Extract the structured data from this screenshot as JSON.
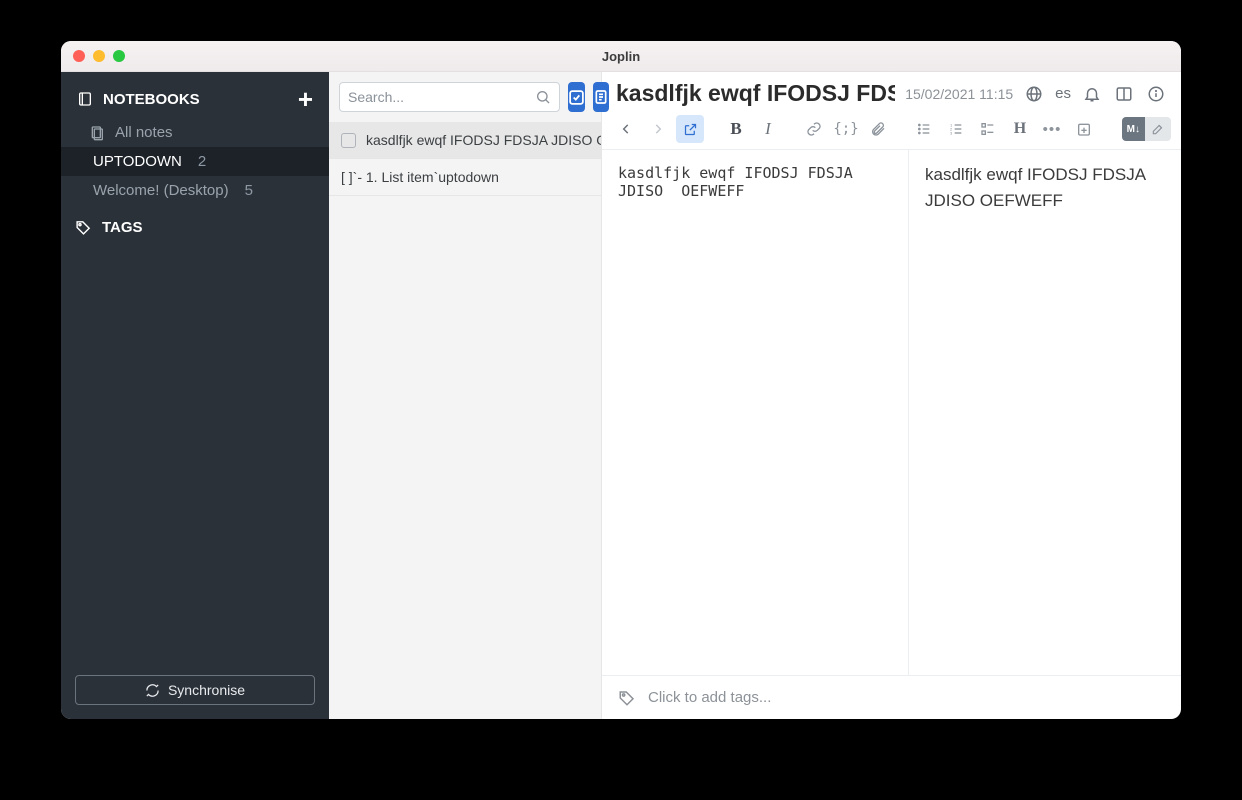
{
  "window": {
    "title": "Joplin"
  },
  "sidebar": {
    "notebooks_label": "NOTEBOOKS",
    "all_notes_label": "All notes",
    "tags_label": "TAGS",
    "items": [
      {
        "label": "UPTODOWN",
        "count": "2",
        "selected": true
      },
      {
        "label": "Welcome! (Desktop)",
        "count": "5",
        "selected": false
      }
    ],
    "sync_label": "Synchronise"
  },
  "notelist": {
    "search_placeholder": "Search...",
    "items": [
      {
        "title": "kasdlfjk ewqf IFODSJ FDSJA JDISO OE",
        "has_checkbox": true,
        "selected": true
      },
      {
        "title": "[ ]`- 1. List item`uptodown",
        "has_checkbox": false,
        "selected": false
      }
    ]
  },
  "editor": {
    "title": "kasdlfjk ewqf IFODSJ FDSJA J",
    "date": "15/02/2021 11:15",
    "lang": "es",
    "source_text": "kasdlfjk ewqf IFODSJ FDSJA\nJDISO  OEFWEFF",
    "preview_text": "kasdlfjk ewqf IFODSJ FDSJA JDISO OEFWEFF",
    "tags_placeholder": "Click to add tags...",
    "md_badge": "M↓"
  }
}
